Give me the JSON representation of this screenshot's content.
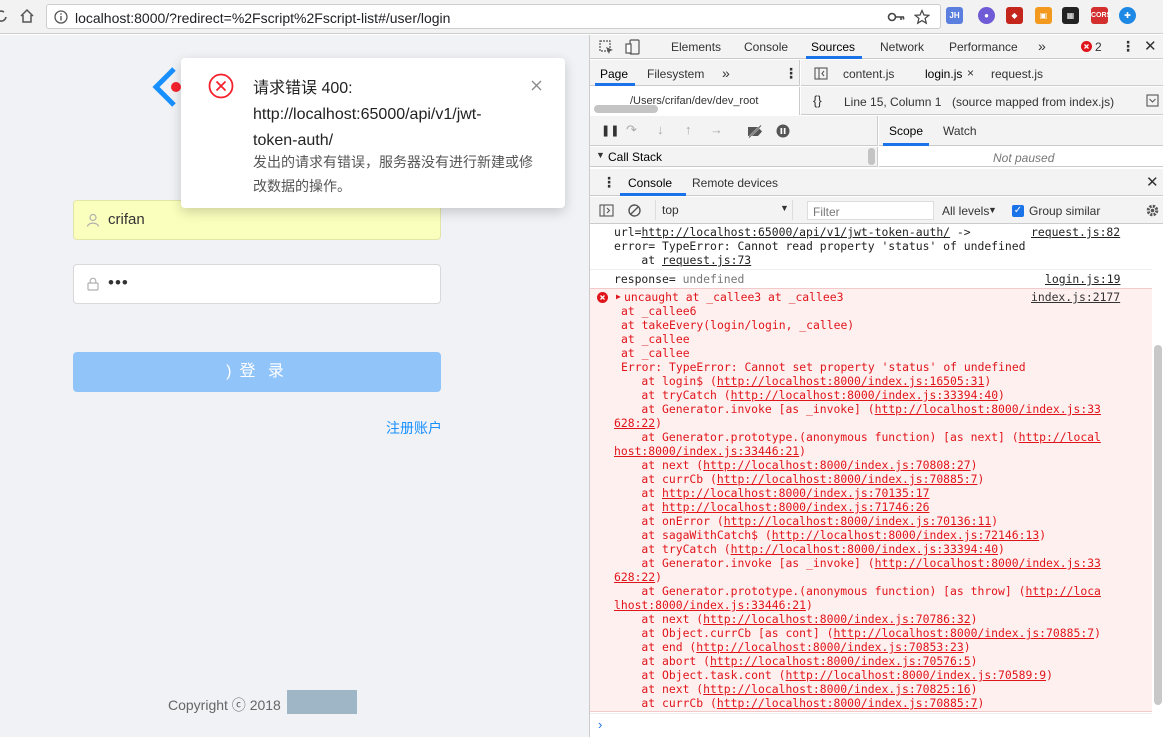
{
  "browser": {
    "url": "localhost:8000/?redirect=%2Fscript%2Fscript-list#/user/login"
  },
  "notification": {
    "title_lines": [
      "请求错误 400:",
      "http://localhost:65000/api/v1/jwt-",
      "token-auth/"
    ],
    "desc_lines": [
      "发出的请求有错误，服务器没有进行新建或修",
      "改数据的操作。"
    ]
  },
  "login": {
    "username": "crifan",
    "password_mask": "•••",
    "button": "登 录",
    "spinner": ")",
    "register": "注册账户",
    "copyright": "Copyright ⓒ 2018"
  },
  "devtools": {
    "tabs": [
      "Elements",
      "Console",
      "Sources",
      "Network",
      "Performance",
      "»"
    ],
    "error_count": "2",
    "nav_tabs": [
      "Page",
      "Filesystem",
      "»"
    ],
    "file_tabs": [
      "content.js",
      "login.js",
      "request.js"
    ],
    "file_path": "/Users/crifan/dev/dev_root",
    "status": "Line 15, Column 1",
    "source_map": "(source mapped from index.js)",
    "scope_tabs": [
      "Scope",
      "Watch"
    ],
    "call_stack": "Call Stack",
    "not_paused": "Not paused",
    "drawer_tabs": [
      "Console",
      "Remote devices"
    ],
    "context": "top",
    "filter_placeholder": "Filter",
    "levels": "All levels",
    "group_similar": "Group similar",
    "console": {
      "pre_lines": [
        {
          "text": "url=",
          "link": "http://localhost:65000/api/v1/jwt-token-auth/",
          "tail": " ->",
          "src": "request.js:82"
        },
        {
          "text": "error= TypeError: Cannot read property 'status' of undefined",
          "link": "",
          "tail": "",
          "src": ""
        },
        {
          "text": "    at ",
          "link": "request.js:73",
          "tail": "",
          "src": ""
        }
      ],
      "response": {
        "text": "response= ",
        "val": "undefined",
        "src": "login.js:19"
      },
      "error_head": "uncaught at _callee3 at _callee3",
      "error_src": "index.js:2177",
      "error_lines": [
        [
          "at _callee6",
          ""
        ],
        [
          "at takeEvery(login/login, _callee)",
          ""
        ],
        [
          "at _callee",
          ""
        ],
        [
          "at _callee",
          ""
        ],
        [
          "Error: TypeError: Cannot set property 'status' of undefined",
          ""
        ],
        [
          "    at login$ (",
          "http://localhost:8000/index.js:16505:31",
          ")"
        ],
        [
          "    at tryCatch (",
          "http://localhost:8000/index.js:33394:40",
          ")"
        ],
        [
          "    at Generator.invoke [as _invoke] (",
          "http://localhost:8000/index.js:33",
          ""
        ],
        [
          "",
          "628:22",
          ")"
        ],
        [
          "    at Generator.prototype.(anonymous function) [as next] (",
          "http://local",
          ""
        ],
        [
          "",
          "host:8000/index.js:33446:21",
          ")"
        ],
        [
          "    at next (",
          "http://localhost:8000/index.js:70808:27",
          ")"
        ],
        [
          "    at currCb (",
          "http://localhost:8000/index.js:70885:7",
          ")"
        ],
        [
          "    at ",
          "http://localhost:8000/index.js:70135:17",
          ""
        ],
        [
          "    at ",
          "http://localhost:8000/index.js:71746:26",
          ""
        ],
        [
          "    at onError (",
          "http://localhost:8000/index.js:70136:11",
          ")"
        ],
        [
          "    at sagaWithCatch$ (",
          "http://localhost:8000/index.js:72146:13",
          ")"
        ],
        [
          "    at tryCatch (",
          "http://localhost:8000/index.js:33394:40",
          ")"
        ],
        [
          "    at Generator.invoke [as _invoke] (",
          "http://localhost:8000/index.js:33",
          ""
        ],
        [
          "",
          "628:22",
          ")"
        ],
        [
          "    at Generator.prototype.(anonymous function) [as throw] (",
          "http://loca",
          ""
        ],
        [
          "",
          "lhost:8000/index.js:33446:21",
          ")"
        ],
        [
          "    at next (",
          "http://localhost:8000/index.js:70786:32",
          ")"
        ],
        [
          "    at Object.currCb [as cont] (",
          "http://localhost:8000/index.js:70885:7",
          ")"
        ],
        [
          "    at end (",
          "http://localhost:8000/index.js:70853:23",
          ")"
        ],
        [
          "    at abort (",
          "http://localhost:8000/index.js:70576:5",
          ")"
        ],
        [
          "    at Object.task.cont (",
          "http://localhost:8000/index.js:70589:9",
          ")"
        ],
        [
          "    at next (",
          "http://localhost:8000/index.js:70825:16",
          ")"
        ],
        [
          "    at currCb (",
          "http://localhost:8000/index.js:70885:7",
          ")"
        ]
      ],
      "prompt": "›"
    }
  },
  "colors": {
    "accent": "#1890ff",
    "error": "#f5222d",
    "console_error": "#e0151a"
  }
}
